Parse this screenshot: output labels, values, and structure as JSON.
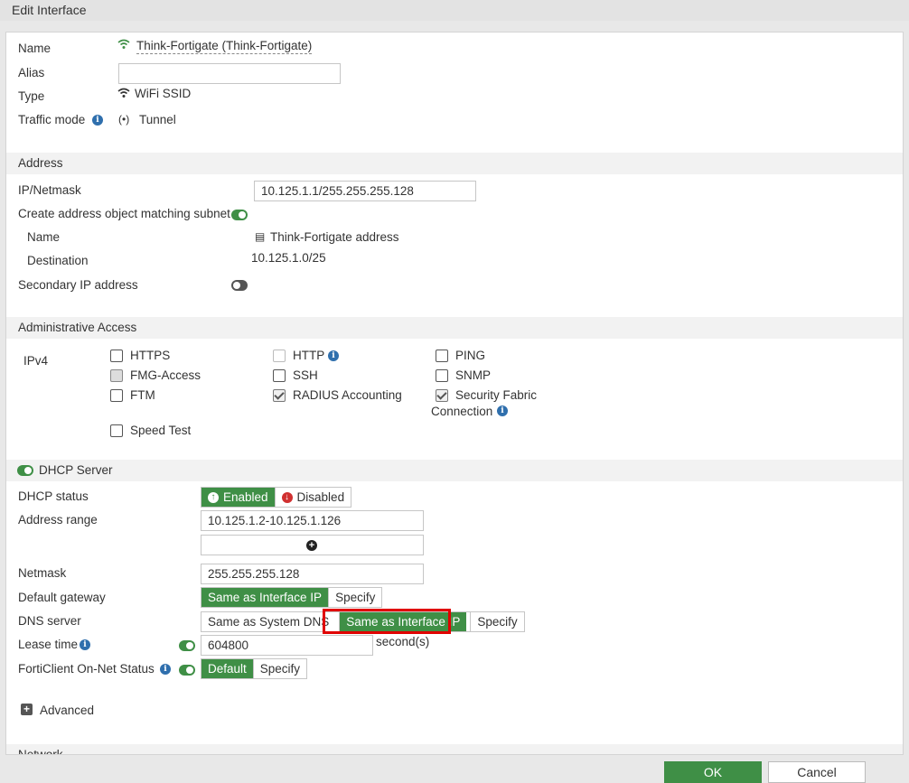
{
  "window": {
    "title": "Edit Interface"
  },
  "general": {
    "name_label": "Name",
    "name_value": "Think-Fortigate (Think-Fortigate)",
    "alias_label": "Alias",
    "alias_value": "",
    "type_label": "Type",
    "type_value": "WiFi SSID",
    "traffic_mode_label": "Traffic mode",
    "traffic_mode_value": "Tunnel"
  },
  "address": {
    "section_title": "Address",
    "ip_label": "IP/Netmask",
    "ip_value": "10.125.1.1/255.255.255.128",
    "create_object_label": "Create address object matching subnet",
    "create_object_enabled": true,
    "obj_name_label": "Name",
    "obj_name_value": "Think-Fortigate address",
    "destination_label": "Destination",
    "destination_value": "10.125.1.0/25",
    "secondary_ip_label": "Secondary IP address",
    "secondary_ip_enabled": false
  },
  "admin_access": {
    "section_title": "Administrative Access",
    "ipv4_label": "IPv4",
    "options": [
      {
        "label": "HTTPS",
        "checked": false
      },
      {
        "label": "HTTP",
        "checked": false
      },
      {
        "label": "PING",
        "checked": false
      },
      {
        "label": "FMG-Access",
        "checked": false
      },
      {
        "label": "SSH",
        "checked": false
      },
      {
        "label": "SNMP",
        "checked": false
      },
      {
        "label": "FTM",
        "checked": false
      },
      {
        "label": "RADIUS Accounting",
        "checked": true
      },
      {
        "label": "Security Fabric",
        "label2": "Connection",
        "checked": true
      },
      {
        "label": "Speed Test",
        "checked": false
      }
    ]
  },
  "dhcp": {
    "section_title": "DHCP Server",
    "enabled": true,
    "status_label": "DHCP status",
    "status_enabled": "Enabled",
    "status_disabled": "Disabled",
    "address_range_label": "Address range",
    "address_range_value": "10.125.1.2-10.125.1.126",
    "netmask_label": "Netmask",
    "netmask_value": "255.255.255.128",
    "gateway_label": "Default gateway",
    "gateway_same": "Same as Interface IP",
    "gateway_specify": "Specify",
    "dns_label": "DNS server",
    "dns_system": "Same as System DNS",
    "dns_same": "Same as Interface IP",
    "dns_specify": "Specify",
    "lease_label": "Lease time",
    "lease_value": "604800",
    "lease_unit": "second(s)",
    "forticlient_label": "FortiClient On-Net Status",
    "forticlient_default": "Default",
    "forticlient_specify": "Specify",
    "advanced_label": "Advanced"
  },
  "network": {
    "section_title": "Network"
  },
  "footer": {
    "ok_label": "OK",
    "cancel_label": "Cancel"
  },
  "colors": {
    "accent": "#3f8f46",
    "highlight": "#e00000",
    "info": "#2f6fad"
  }
}
